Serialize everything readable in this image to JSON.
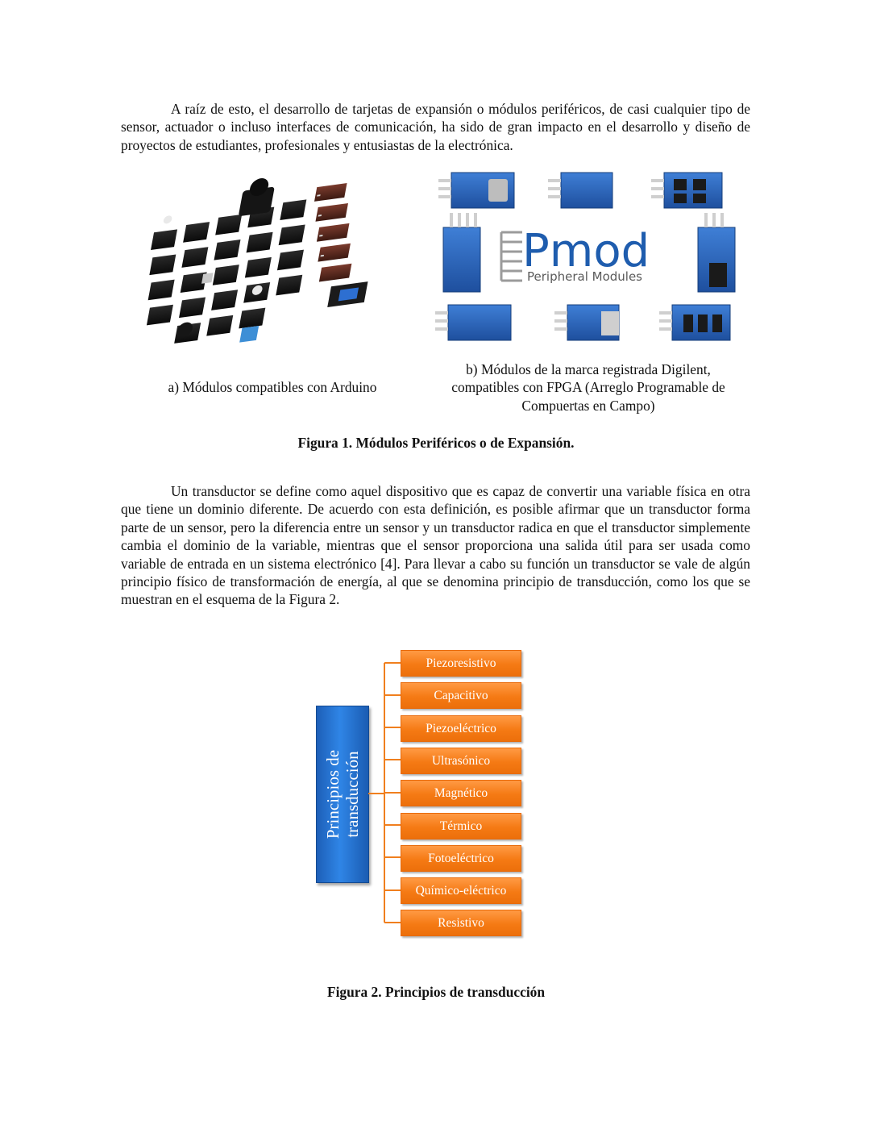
{
  "paragraphs": {
    "p1": "A raíz de esto, el desarrollo de tarjetas de expansión o módulos periféricos, de casi cualquier tipo de sensor, actuador o incluso interfaces de comunicación, ha sido de gran impacto en el desarrollo y diseño de proyectos de estudiantes, profesionales y entusiastas de la electrónica.",
    "p2": "Un transductor se define como aquel dispositivo que es capaz de convertir una variable física en otra que tiene un dominio diferente. De acuerdo con esta definición, es posible afirmar que un transductor forma parte de un sensor, pero la diferencia entre un sensor y un transductor radica en que el transductor simplemente cambia el dominio de la variable, mientras que el sensor proporciona una salida útil para ser usada como variable de entrada en un sistema electrónico [4]. Para llevar a cabo su función un transductor se vale de algún principio físico de transformación de energía, al que se denomina principio de transducción, como los que se muestran en el esquema de la Figura 2."
  },
  "figure1": {
    "pmod_logo_text": "Pmod",
    "pmod_logo_subtitle": "Peripheral Modules",
    "caption_a": "a) Módulos compatibles con Arduino",
    "caption_b_line1": "b) Módulos de la marca registrada Digilent,",
    "caption_b_line2": "compatibles con FPGA (Arreglo Programable de",
    "caption_b_line3": "Compuertas en Campo)",
    "caption": "Figura 1. Módulos Periféricos o de Expansión."
  },
  "figure2": {
    "root_line1": "Principios de",
    "root_line2": "transducción",
    "leaves": [
      "Piezoresistivo",
      "Capacitivo",
      "Piezoeléctrico",
      "Ultrasónico",
      "Magnético",
      "Térmico",
      "Fotoeléctrico",
      "Químico-eléctrico",
      "Resistivo"
    ],
    "caption": "Figura 2. Principios de transducción",
    "colors": {
      "root": "#2f85e6",
      "leaf": "#f57a14",
      "connector": "#f07f1e"
    }
  }
}
